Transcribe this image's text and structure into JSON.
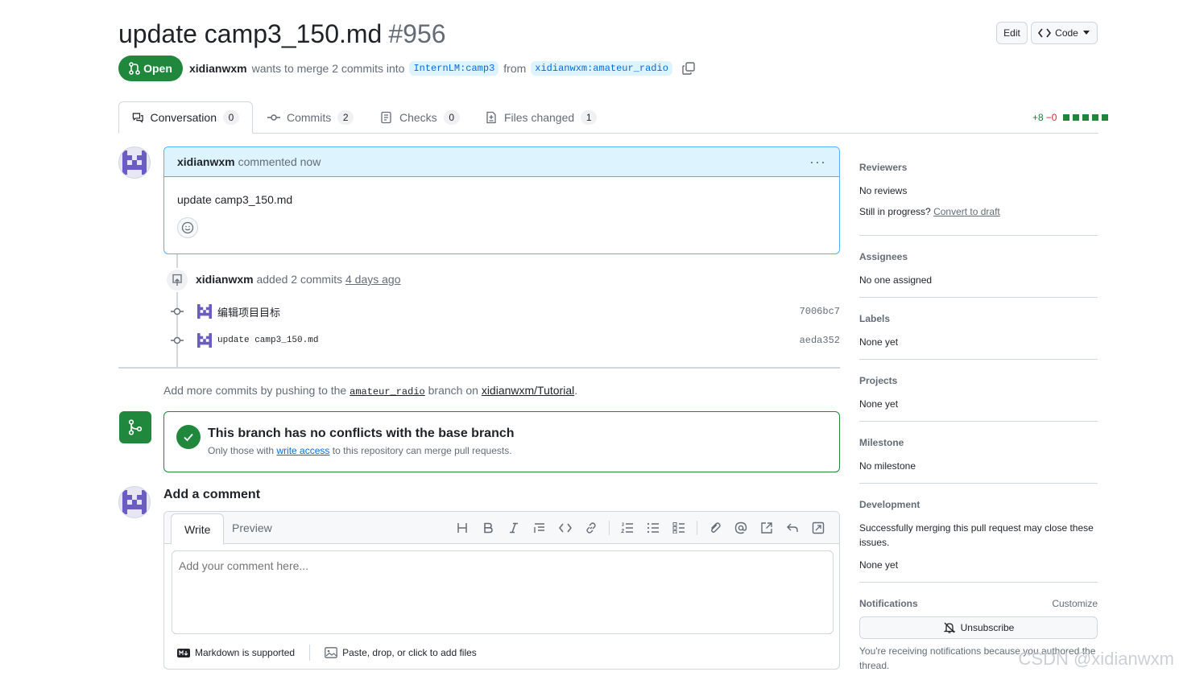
{
  "pr": {
    "title": "update camp3_150.md",
    "number": "#956",
    "state": "Open",
    "author": "xidianwxm",
    "merge_text": "wants to merge 2 commits into",
    "base_branch": "InternLM:camp3",
    "from_text": "from",
    "head_branch": "xidianwxm:amateur_radio"
  },
  "header_buttons": {
    "edit": "Edit",
    "code": "Code"
  },
  "tabs": [
    {
      "label": "Conversation",
      "count": "0"
    },
    {
      "label": "Commits",
      "count": "2"
    },
    {
      "label": "Checks",
      "count": "0"
    },
    {
      "label": "Files changed",
      "count": "1"
    }
  ],
  "diffstat": {
    "added": "+8",
    "removed": "−0"
  },
  "comment": {
    "author": "xidianwxm",
    "action": "commented now",
    "body": "update camp3_150.md"
  },
  "commit_event": {
    "author": "xidianwxm",
    "action": "added 2 commits",
    "time": "4 days ago",
    "commits": [
      {
        "message": "编辑项目目标",
        "sha": "7006bc7"
      },
      {
        "message": "update camp3_150.md",
        "sha": "aeda352"
      }
    ]
  },
  "push_hint": {
    "prefix": "Add more commits by pushing to the",
    "branch": "amateur_radio",
    "middle": "branch on",
    "repo": "xidianwxm/Tutorial",
    "suffix": "."
  },
  "merge_status": {
    "title": "This branch has no conflicts with the base branch",
    "sub_prefix": "Only those with",
    "sub_link": "write access",
    "sub_suffix": "to this repository can merge pull requests."
  },
  "add_comment": {
    "title": "Add a comment",
    "tab_write": "Write",
    "tab_preview": "Preview",
    "placeholder": "Add your comment here...",
    "markdown_note": "Markdown is supported",
    "files_note": "Paste, drop, or click to add files"
  },
  "sidebar": {
    "reviewers": {
      "title": "Reviewers",
      "value": "No reviews",
      "draft_prefix": "Still in progress?",
      "draft_link": "Convert to draft"
    },
    "assignees": {
      "title": "Assignees",
      "value": "No one assigned"
    },
    "labels": {
      "title": "Labels",
      "value": "None yet"
    },
    "projects": {
      "title": "Projects",
      "value": "None yet"
    },
    "milestone": {
      "title": "Milestone",
      "value": "No milestone"
    },
    "development": {
      "title": "Development",
      "description": "Successfully merging this pull request may close these issues.",
      "value": "None yet"
    },
    "notifications": {
      "title": "Notifications",
      "customize": "Customize",
      "unsubscribe": "Unsubscribe",
      "notice": "You're receiving notifications because you authored the thread."
    }
  },
  "watermark": "CSDN @xidianwxm",
  "colors": {
    "accent_green": "#1f883d",
    "link_blue": "#0969da",
    "comment_header_bg": "#ddf4ff"
  }
}
